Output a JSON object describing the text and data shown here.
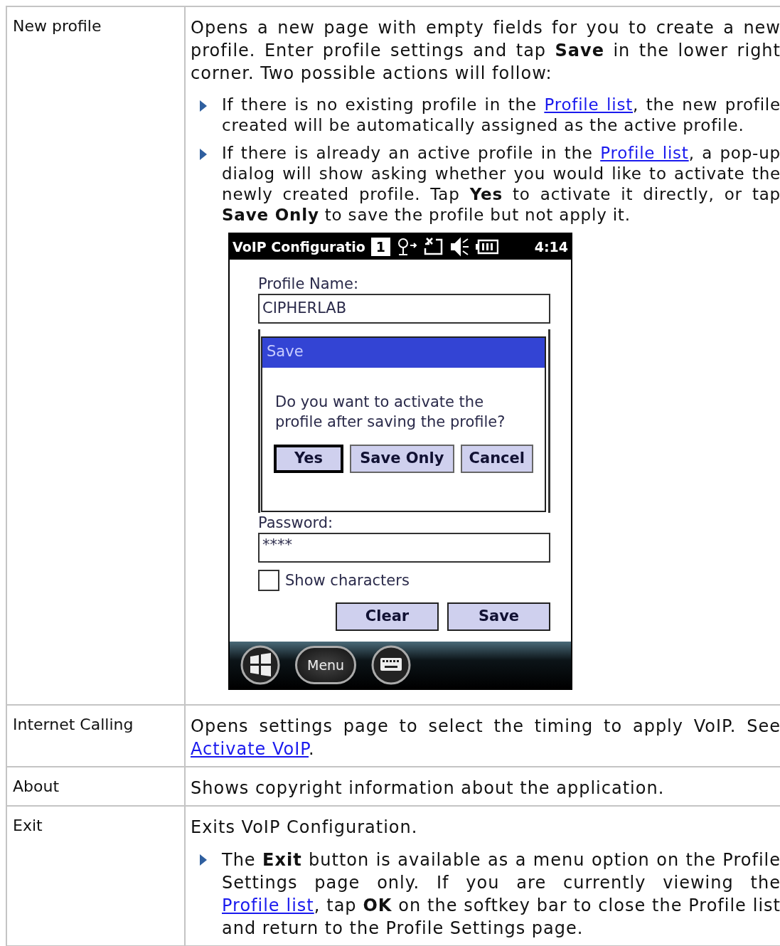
{
  "table": {
    "rows": [
      {
        "term": "New profile",
        "content": [
          {
            "kind": "paragraph",
            "parts": [
              {
                "text": "Opens a new page with empty fields for you to create a new profile. Enter profile settings and tap **Save** in the lower right corner. Two possible actions will follow:",
                "kind": "text"
              }
            ]
          },
          {
            "kind": "bullet",
            "parts": [
              {
                "text": "If there is no existing profile in the ",
                "kind": "text"
              },
              {
                "text": "Profile list",
                "kind": "link"
              },
              {
                "text": ", the new profile created will be automatically assigned as the active profile.",
                "kind": "text"
              }
            ]
          },
          {
            "kind": "bullet",
            "parts": [
              {
                "text": "If there is already an active profile in the ",
                "kind": "text"
              },
              {
                "text": "Profile list",
                "kind": "link"
              },
              {
                "text": ", a pop-up dialog will show asking whether you would like to activate the newly created profile. Tap **Yes** to activate it directly, or tap **Save Only** to save the profile but not apply it.",
                "kind": "text"
              }
            ]
          },
          {
            "kind": "screenshot",
            "screen": {
              "title_bar": {
                "title": "VoIP Configuratio",
                "badge": "1",
                "time": "4:14"
              },
              "profile_name": {
                "label": "Profile Name:",
                "value": "CIPHERLAB"
              },
              "dialog": {
                "title": "Save",
                "message": "Do you want to activate the profile after saving the profile?",
                "buttons": [
                  {
                    "label": "Yes",
                    "focused": true
                  },
                  {
                    "label": "Save Only",
                    "focused": false
                  },
                  {
                    "label": "Cancel",
                    "focused": false
                  }
                ]
              },
              "password": {
                "label": "Password:",
                "value": "****"
              },
              "show_characters": {
                "label": "Show characters",
                "checked": false
              },
              "buttons": [
                "Clear",
                "Save"
              ],
              "taskbar": {
                "menu": "Menu"
              }
            }
          }
        ]
      },
      {
        "term": "Internet Calling",
        "content": [
          {
            "kind": "paragraph",
            "parts": [
              {
                "text": "Opens settings page to select the timing to apply VoIP. See ",
                "kind": "text"
              },
              {
                "text": "Activate VoIP",
                "kind": "link"
              },
              {
                "text": ".",
                "kind": "text"
              }
            ]
          }
        ]
      },
      {
        "term": "About",
        "content": [
          {
            "kind": "paragraph",
            "parts": [
              {
                "text": "Shows copyright information about the application.",
                "kind": "text"
              }
            ]
          }
        ]
      },
      {
        "term": "Exit",
        "content": [
          {
            "kind": "paragraph",
            "parts": [
              {
                "text": "Exits VoIP Configuration.",
                "kind": "text"
              }
            ]
          },
          {
            "kind": "bullet",
            "parts": [
              {
                "text": "The **Exit** button is available as a menu option on the Profile Settings page only. If you are currently viewing the ",
                "kind": "text"
              },
              {
                "text": "Profile list",
                "kind": "link"
              },
              {
                "text": ", tap **OK** on the softkey bar to close the Profile list and return to the Profile Settings page.",
                "kind": "text"
              }
            ]
          }
        ]
      }
    ]
  }
}
